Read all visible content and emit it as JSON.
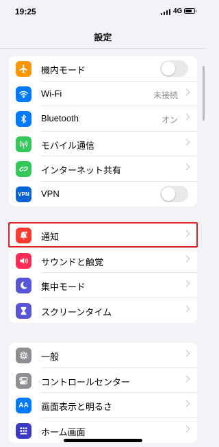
{
  "status": {
    "time": "19:25",
    "network": "4G"
  },
  "title": "設定",
  "groups": [
    {
      "items": [
        {
          "label": "機内モード",
          "icon": "airplane-icon",
          "color": "#ff9500",
          "accessory": "toggle",
          "toggle_on": false
        },
        {
          "label": "Wi-Fi",
          "icon": "wifi-icon",
          "color": "#007aff",
          "value": "未接続"
        },
        {
          "label": "Bluetooth",
          "icon": "bluetooth-icon",
          "color": "#007aff",
          "value": "オン"
        },
        {
          "label": "モバイル通信",
          "icon": "antenna-icon",
          "color": "#34c759"
        },
        {
          "label": "インターネット共有",
          "icon": "hotspot-icon",
          "color": "#34c759"
        },
        {
          "label": "VPN",
          "icon": "vpn-icon",
          "icon_text": "VPN",
          "color": "#0a64d6",
          "accessory": "toggle",
          "toggle_on": false
        }
      ]
    },
    {
      "items": [
        {
          "label": "通知",
          "icon": "bell-icon",
          "color": "#ff3b30"
        },
        {
          "label": "サウンドと触覚",
          "icon": "speaker-icon",
          "color": "#ff2d55"
        },
        {
          "label": "集中モード",
          "icon": "moon-icon",
          "color": "#5856d6"
        },
        {
          "label": "スクリーンタイム",
          "icon": "hourglass-icon",
          "color": "#5856d6"
        }
      ]
    },
    {
      "items": [
        {
          "label": "一般",
          "icon": "gear-icon",
          "color": "#8e8e93"
        },
        {
          "label": "コントロールセンター",
          "icon": "switches-icon",
          "color": "#8e8e93"
        },
        {
          "label": "画面表示と明るさ",
          "icon": "text-size-icon",
          "icon_text": "AA",
          "color": "#007aff"
        },
        {
          "label": "ホーム画面",
          "icon": "home-grid-icon",
          "color": "#3a3ac2"
        }
      ]
    }
  ]
}
